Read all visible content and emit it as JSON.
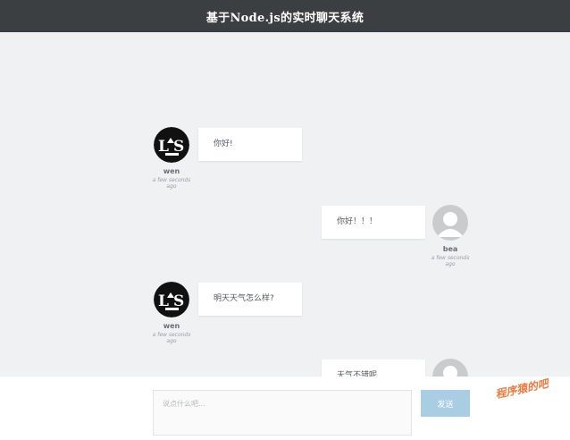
{
  "header": {
    "title": "基于Node.js的实时聊天系统"
  },
  "messages": [
    {
      "side": "left",
      "username": "wen",
      "time": "a few seconds ago",
      "text": "你好!",
      "avatar": "logo-avatar-icon"
    },
    {
      "side": "right",
      "username": "bea",
      "time": "a few seconds ago",
      "text": "你好！！！",
      "avatar": "default-avatar-icon"
    },
    {
      "side": "left",
      "username": "wen",
      "time": "a few seconds ago",
      "text": "明天天气怎么样?",
      "avatar": "logo-avatar-icon"
    },
    {
      "side": "right",
      "username": "",
      "time": "",
      "text": "天气不错呢",
      "avatar": "default-avatar-icon"
    }
  ],
  "composer": {
    "placeholder": "说点什么吧...",
    "send_label": "发送"
  },
  "watermark": "程序猿的吧",
  "colors": {
    "header_bg": "#3b3f41",
    "page_bg": "#f0f1f2",
    "send_button": "#a9cde2",
    "watermark": "#e97b40"
  }
}
